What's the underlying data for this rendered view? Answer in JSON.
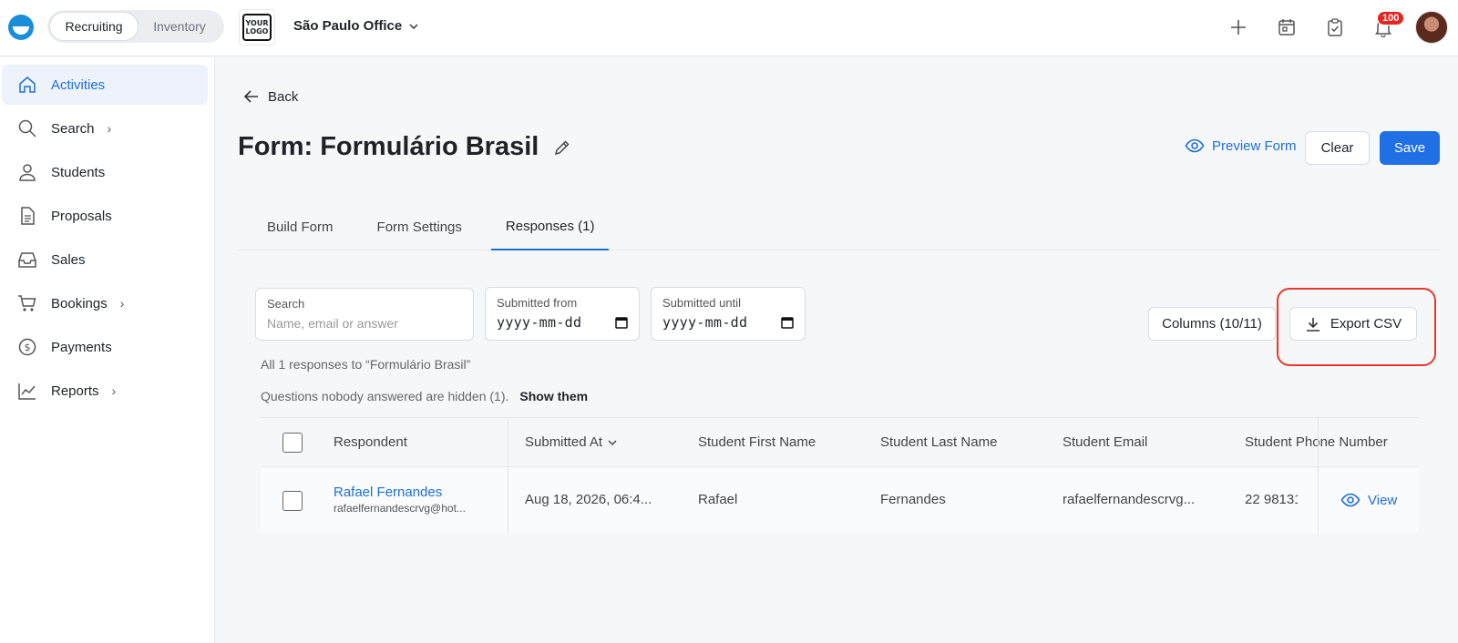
{
  "topbar": {
    "segments": [
      {
        "label": "Recruiting"
      },
      {
        "label": "Inventory"
      }
    ],
    "logo_text": "YOUR LOGO",
    "office": "São Paulo Office",
    "notification_count": "100"
  },
  "sidebar": {
    "items": [
      {
        "label": "Activities",
        "icon": "home-icon"
      },
      {
        "label": "Search",
        "icon": "search-icon",
        "chevron": "›"
      },
      {
        "label": "Students",
        "icon": "user-icon"
      },
      {
        "label": "Proposals",
        "icon": "document-icon"
      },
      {
        "label": "Sales",
        "icon": "inbox-icon"
      },
      {
        "label": "Bookings",
        "icon": "cart-icon",
        "chevron": "›"
      },
      {
        "label": "Payments",
        "icon": "dollar-icon"
      },
      {
        "label": "Reports",
        "icon": "chart-icon",
        "chevron": "›"
      }
    ]
  },
  "header": {
    "back_label": "Back",
    "title": "Form: Formulário Brasil",
    "preview_label": "Preview Form",
    "clear_label": "Clear",
    "save_label": "Save"
  },
  "tabs": [
    {
      "label": "Build Form"
    },
    {
      "label": "Form Settings"
    },
    {
      "label": "Responses (1)"
    }
  ],
  "filters": {
    "search": {
      "label": "Search",
      "placeholder": "Name, email or answer"
    },
    "from": {
      "label": "Submitted from",
      "value": "yyyy-mm-dd"
    },
    "until": {
      "label": "Submitted until",
      "value": "yyyy-mm-dd"
    }
  },
  "toolbar": {
    "columns_label": "Columns (10/11)",
    "export_label": "Export CSV"
  },
  "summary": "All 1 responses to “Formulário Brasil”",
  "hidden_note": "Questions nobody answered are hidden (1).",
  "show_them": "Show them",
  "table": {
    "headers": [
      "Respondent",
      "Submitted At",
      "Student First Name",
      "Student Last Name",
      "Student Email",
      "Student Phone Number"
    ],
    "rows": [
      {
        "name": "Rafael Fernandes",
        "email": "rafaelfernandescrvg@hot...",
        "submitted_at": "Aug 18, 2026, 06:4...",
        "first_name": "Rafael",
        "last_name": "Fernandes",
        "student_email": "rafaelfernandescrvg...",
        "phone": "22 98131",
        "view_label": "View"
      }
    ]
  },
  "colors": {
    "accent": "#1f6fd6",
    "save": "#1f6fe5",
    "badge": "#e5261f",
    "highlight": "#e53a2d"
  }
}
